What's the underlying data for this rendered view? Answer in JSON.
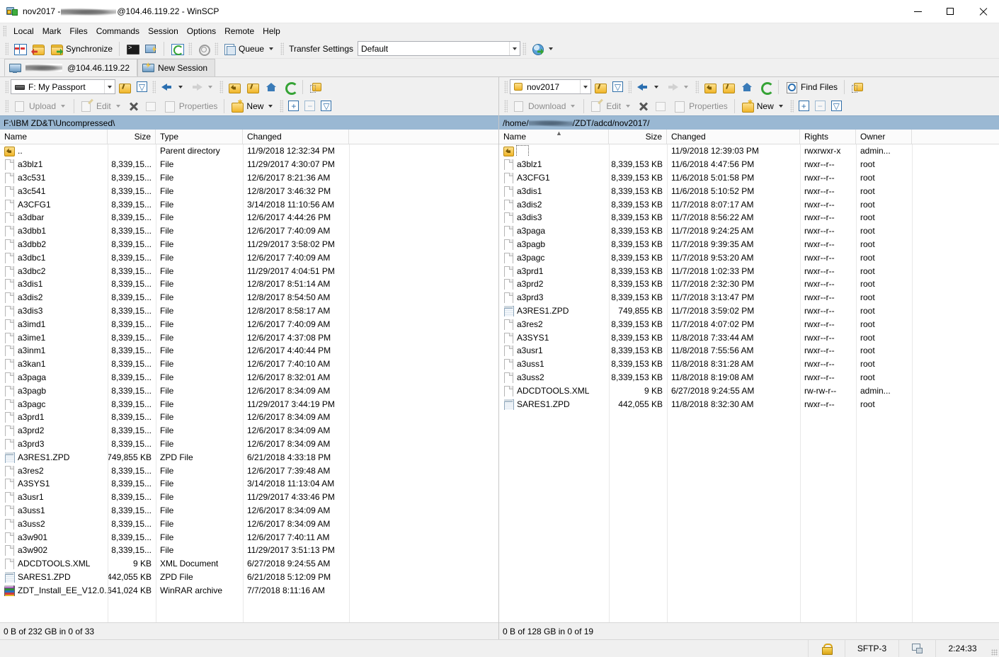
{
  "window": {
    "title_prefix": "nov2017 - ",
    "title_redacted": true,
    "title_suffix": "@104.46.119.22 - WinSCP",
    "minimize_label": "Minimize",
    "maximize_label": "Maximize",
    "close_label": "Close"
  },
  "menu": {
    "items": [
      "Local",
      "Mark",
      "Files",
      "Commands",
      "Session",
      "Options",
      "Remote",
      "Help"
    ]
  },
  "toolbar": {
    "compare_label": "",
    "synchronize_label": "Synchronize",
    "queue_label": "Queue",
    "transfer_settings_label": "Transfer Settings",
    "transfer_settings_value": "Default"
  },
  "tabs": {
    "session_tab_label": "@104.46.119.22",
    "new_session_label": "New Session"
  },
  "local": {
    "drive_value": "F: My Passport",
    "upload_label": "Upload",
    "edit_label": "Edit",
    "properties_label": "Properties",
    "new_label": "New",
    "path": "F:\\IBM ZD&T\\Uncompressed\\",
    "columns": [
      "Name",
      "Size",
      "Type",
      "Changed"
    ],
    "status": "0 B of 232 GB in 0 of 33",
    "rows": [
      {
        "icon": "parent",
        "name": "..",
        "size": "",
        "type": "Parent directory",
        "changed": "11/9/2018  12:32:34 PM"
      },
      {
        "icon": "file",
        "name": "a3blz1",
        "size": "8,339,15...",
        "type": "File",
        "changed": "11/29/2017  4:30:07 PM"
      },
      {
        "icon": "file",
        "name": "a3c531",
        "size": "8,339,15...",
        "type": "File",
        "changed": "12/6/2017  8:21:36 AM"
      },
      {
        "icon": "file",
        "name": "a3c541",
        "size": "8,339,15...",
        "type": "File",
        "changed": "12/8/2017  3:46:32 PM"
      },
      {
        "icon": "file",
        "name": "A3CFG1",
        "size": "8,339,15...",
        "type": "File",
        "changed": "3/14/2018  11:10:56 AM"
      },
      {
        "icon": "file",
        "name": "a3dbar",
        "size": "8,339,15...",
        "type": "File",
        "changed": "12/6/2017  4:44:26 PM"
      },
      {
        "icon": "file",
        "name": "a3dbb1",
        "size": "8,339,15...",
        "type": "File",
        "changed": "12/6/2017  7:40:09 AM"
      },
      {
        "icon": "file",
        "name": "a3dbb2",
        "size": "8,339,15...",
        "type": "File",
        "changed": "11/29/2017  3:58:02 PM"
      },
      {
        "icon": "file",
        "name": "a3dbc1",
        "size": "8,339,15...",
        "type": "File",
        "changed": "12/6/2017  7:40:09 AM"
      },
      {
        "icon": "file",
        "name": "a3dbc2",
        "size": "8,339,15...",
        "type": "File",
        "changed": "11/29/2017  4:04:51 PM"
      },
      {
        "icon": "file",
        "name": "a3dis1",
        "size": "8,339,15...",
        "type": "File",
        "changed": "12/8/2017  8:51:14 AM"
      },
      {
        "icon": "file",
        "name": "a3dis2",
        "size": "8,339,15...",
        "type": "File",
        "changed": "12/8/2017  8:54:50 AM"
      },
      {
        "icon": "file",
        "name": "a3dis3",
        "size": "8,339,15...",
        "type": "File",
        "changed": "12/8/2017  8:58:17 AM"
      },
      {
        "icon": "file",
        "name": "a3imd1",
        "size": "8,339,15...",
        "type": "File",
        "changed": "12/6/2017  7:40:09 AM"
      },
      {
        "icon": "file",
        "name": "a3ime1",
        "size": "8,339,15...",
        "type": "File",
        "changed": "12/6/2017  4:37:08 PM"
      },
      {
        "icon": "file",
        "name": "a3inm1",
        "size": "8,339,15...",
        "type": "File",
        "changed": "12/6/2017  4:40:44 PM"
      },
      {
        "icon": "file",
        "name": "a3kan1",
        "size": "8,339,15...",
        "type": "File",
        "changed": "12/6/2017  7:40:10 AM"
      },
      {
        "icon": "file",
        "name": "a3paga",
        "size": "8,339,15...",
        "type": "File",
        "changed": "12/6/2017  8:32:01 AM"
      },
      {
        "icon": "file",
        "name": "a3pagb",
        "size": "8,339,15...",
        "type": "File",
        "changed": "12/6/2017  8:34:09 AM"
      },
      {
        "icon": "file",
        "name": "a3pagc",
        "size": "8,339,15...",
        "type": "File",
        "changed": "11/29/2017  3:44:19 PM"
      },
      {
        "icon": "file",
        "name": "a3prd1",
        "size": "8,339,15...",
        "type": "File",
        "changed": "12/6/2017  8:34:09 AM"
      },
      {
        "icon": "file",
        "name": "a3prd2",
        "size": "8,339,15...",
        "type": "File",
        "changed": "12/6/2017  8:34:09 AM"
      },
      {
        "icon": "file",
        "name": "a3prd3",
        "size": "8,339,15...",
        "type": "File",
        "changed": "12/6/2017  8:34:09 AM"
      },
      {
        "icon": "zpd",
        "name": "A3RES1.ZPD",
        "size": "749,855 KB",
        "type": "ZPD File",
        "changed": "6/21/2018  4:33:18 PM"
      },
      {
        "icon": "file",
        "name": "a3res2",
        "size": "8,339,15...",
        "type": "File",
        "changed": "12/6/2017  7:39:48 AM"
      },
      {
        "icon": "file",
        "name": "A3SYS1",
        "size": "8,339,15...",
        "type": "File",
        "changed": "3/14/2018  11:13:04 AM"
      },
      {
        "icon": "file",
        "name": "a3usr1",
        "size": "8,339,15...",
        "type": "File",
        "changed": "11/29/2017  4:33:46 PM"
      },
      {
        "icon": "file",
        "name": "a3uss1",
        "size": "8,339,15...",
        "type": "File",
        "changed": "12/6/2017  8:34:09 AM"
      },
      {
        "icon": "file",
        "name": "a3uss2",
        "size": "8,339,15...",
        "type": "File",
        "changed": "12/6/2017  8:34:09 AM"
      },
      {
        "icon": "file",
        "name": "a3w901",
        "size": "8,339,15...",
        "type": "File",
        "changed": "12/6/2017  7:40:11 AM"
      },
      {
        "icon": "file",
        "name": "a3w902",
        "size": "8,339,15...",
        "type": "File",
        "changed": "11/29/2017  3:51:13 PM"
      },
      {
        "icon": "xml",
        "name": "ADCDTOOLS.XML",
        "size": "9 KB",
        "type": "XML Document",
        "changed": "6/27/2018  9:24:55 AM"
      },
      {
        "icon": "zpd",
        "name": "SARES1.ZPD",
        "size": "442,055 KB",
        "type": "ZPD File",
        "changed": "6/21/2018  5:12:09 PM"
      },
      {
        "icon": "rar",
        "name": "ZDT_Install_EE_V12.0....",
        "size": "641,024 KB",
        "type": "WinRAR archive",
        "changed": "7/7/2018  8:11:16 AM"
      }
    ]
  },
  "remote": {
    "dir_value": "nov2017",
    "find_files_label": "Find Files",
    "download_label": "Download",
    "edit_label": "Edit",
    "properties_label": "Properties",
    "new_label": "New",
    "path_prefix": "/home/",
    "path_redacted": true,
    "path_suffix": "/ZDT/adcd/nov2017/",
    "columns": [
      "Name",
      "Size",
      "Changed",
      "Rights",
      "Owner"
    ],
    "status": "0 B of 128 GB in 0 of 19",
    "rows": [
      {
        "icon": "parent",
        "name": "",
        "focused": true,
        "size": "",
        "changed": "11/9/2018 12:39:03 PM",
        "rights": "rwxrwxr-x",
        "owner": "admin..."
      },
      {
        "icon": "file",
        "name": "a3blz1",
        "size": "8,339,153 KB",
        "changed": "11/6/2018 4:47:56 PM",
        "rights": "rwxr--r--",
        "owner": "root"
      },
      {
        "icon": "file",
        "name": "A3CFG1",
        "size": "8,339,153 KB",
        "changed": "11/6/2018 5:01:58 PM",
        "rights": "rwxr--r--",
        "owner": "root"
      },
      {
        "icon": "file",
        "name": "a3dis1",
        "size": "8,339,153 KB",
        "changed": "11/6/2018 5:10:52 PM",
        "rights": "rwxr--r--",
        "owner": "root"
      },
      {
        "icon": "file",
        "name": "a3dis2",
        "size": "8,339,153 KB",
        "changed": "11/7/2018 8:07:17 AM",
        "rights": "rwxr--r--",
        "owner": "root"
      },
      {
        "icon": "file",
        "name": "a3dis3",
        "size": "8,339,153 KB",
        "changed": "11/7/2018 8:56:22 AM",
        "rights": "rwxr--r--",
        "owner": "root"
      },
      {
        "icon": "file",
        "name": "a3paga",
        "size": "8,339,153 KB",
        "changed": "11/7/2018 9:24:25 AM",
        "rights": "rwxr--r--",
        "owner": "root"
      },
      {
        "icon": "file",
        "name": "a3pagb",
        "size": "8,339,153 KB",
        "changed": "11/7/2018 9:39:35 AM",
        "rights": "rwxr--r--",
        "owner": "root"
      },
      {
        "icon": "file",
        "name": "a3pagc",
        "size": "8,339,153 KB",
        "changed": "11/7/2018 9:53:20 AM",
        "rights": "rwxr--r--",
        "owner": "root"
      },
      {
        "icon": "file",
        "name": "a3prd1",
        "size": "8,339,153 KB",
        "changed": "11/7/2018 1:02:33 PM",
        "rights": "rwxr--r--",
        "owner": "root"
      },
      {
        "icon": "file",
        "name": "a3prd2",
        "size": "8,339,153 KB",
        "changed": "11/7/2018 2:32:30 PM",
        "rights": "rwxr--r--",
        "owner": "root"
      },
      {
        "icon": "file",
        "name": "a3prd3",
        "size": "8,339,153 KB",
        "changed": "11/7/2018 3:13:47 PM",
        "rights": "rwxr--r--",
        "owner": "root"
      },
      {
        "icon": "zpd",
        "name": "A3RES1.ZPD",
        "size": "749,855 KB",
        "changed": "11/7/2018 3:59:02 PM",
        "rights": "rwxr--r--",
        "owner": "root"
      },
      {
        "icon": "file",
        "name": "a3res2",
        "size": "8,339,153 KB",
        "changed": "11/7/2018 4:07:02 PM",
        "rights": "rwxr--r--",
        "owner": "root"
      },
      {
        "icon": "file",
        "name": "A3SYS1",
        "size": "8,339,153 KB",
        "changed": "11/8/2018 7:33:44 AM",
        "rights": "rwxr--r--",
        "owner": "root"
      },
      {
        "icon": "file",
        "name": "a3usr1",
        "size": "8,339,153 KB",
        "changed": "11/8/2018 7:55:56 AM",
        "rights": "rwxr--r--",
        "owner": "root"
      },
      {
        "icon": "file",
        "name": "a3uss1",
        "size": "8,339,153 KB",
        "changed": "11/8/2018 8:31:28 AM",
        "rights": "rwxr--r--",
        "owner": "root"
      },
      {
        "icon": "file",
        "name": "a3uss2",
        "size": "8,339,153 KB",
        "changed": "11/8/2018 8:19:08 AM",
        "rights": "rwxr--r--",
        "owner": "root"
      },
      {
        "icon": "xml",
        "name": "ADCDTOOLS.XML",
        "size": "9 KB",
        "changed": "6/27/2018 9:24:55 AM",
        "rights": "rw-rw-r--",
        "owner": "admin..."
      },
      {
        "icon": "zpd",
        "name": "SARES1.ZPD",
        "size": "442,055 KB",
        "changed": "11/8/2018 8:32:30 AM",
        "rights": "rwxr--r--",
        "owner": "root"
      }
    ]
  },
  "statusbar": {
    "protocol": "SFTP-3",
    "duration": "2:24:33"
  },
  "colors": {
    "path_bar": "#9ab8d3",
    "chrome": "#f0f0f0",
    "folder": "#f0b52a",
    "accent": "#2b6fb0"
  }
}
